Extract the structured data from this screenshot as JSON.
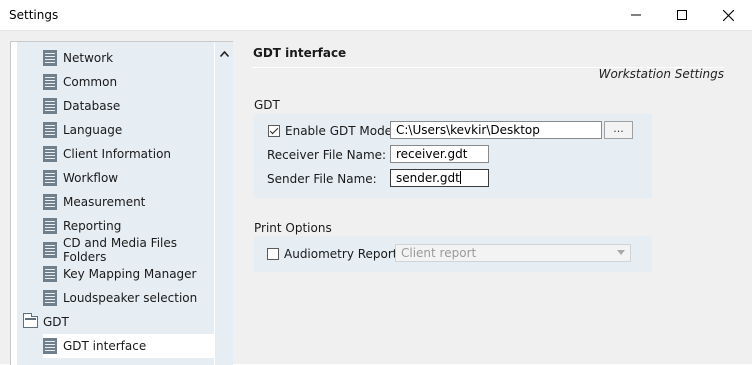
{
  "window": {
    "title": "Settings",
    "controls": {
      "minimize": "minimize-icon",
      "maximize": "maximize-icon",
      "close": "close-icon"
    }
  },
  "sidebar": {
    "items": [
      {
        "label": "Network",
        "icon": "document-icon"
      },
      {
        "label": "Common",
        "icon": "document-icon"
      },
      {
        "label": "Database",
        "icon": "document-icon"
      },
      {
        "label": "Language",
        "icon": "document-icon"
      },
      {
        "label": "Client Information",
        "icon": "document-icon"
      },
      {
        "label": "Workflow",
        "icon": "document-icon"
      },
      {
        "label": "Measurement",
        "icon": "document-icon"
      },
      {
        "label": "Reporting",
        "icon": "document-icon"
      },
      {
        "label": "CD and Media Files Folders",
        "icon": "document-icon"
      },
      {
        "label": "Key Mapping Manager",
        "icon": "document-icon"
      },
      {
        "label": "Loudspeaker selection",
        "icon": "document-icon"
      }
    ],
    "group": {
      "label": "GDT",
      "icon": "folder-icon"
    },
    "group_items": [
      {
        "label": "GDT interface",
        "icon": "document-icon",
        "selected": true
      }
    ]
  },
  "main": {
    "title": "GDT interface",
    "subtitle": "Workstation Settings",
    "gdt": {
      "label": "GDT",
      "enable": {
        "label": "Enable GDT Mode",
        "checked": true
      },
      "folder_value": "C:\\Users\\kevkir\\Desktop",
      "browse_label": "...",
      "receiver": {
        "label": "Receiver File Name:",
        "value": "receiver.gdt"
      },
      "sender": {
        "label": "Sender File Name:",
        "value": "sender.gdt"
      }
    },
    "print": {
      "label": "Print Options",
      "audiometry": {
        "label": "Audiometry Report",
        "checked": false
      },
      "report_select": {
        "value": "Client report"
      }
    }
  }
}
